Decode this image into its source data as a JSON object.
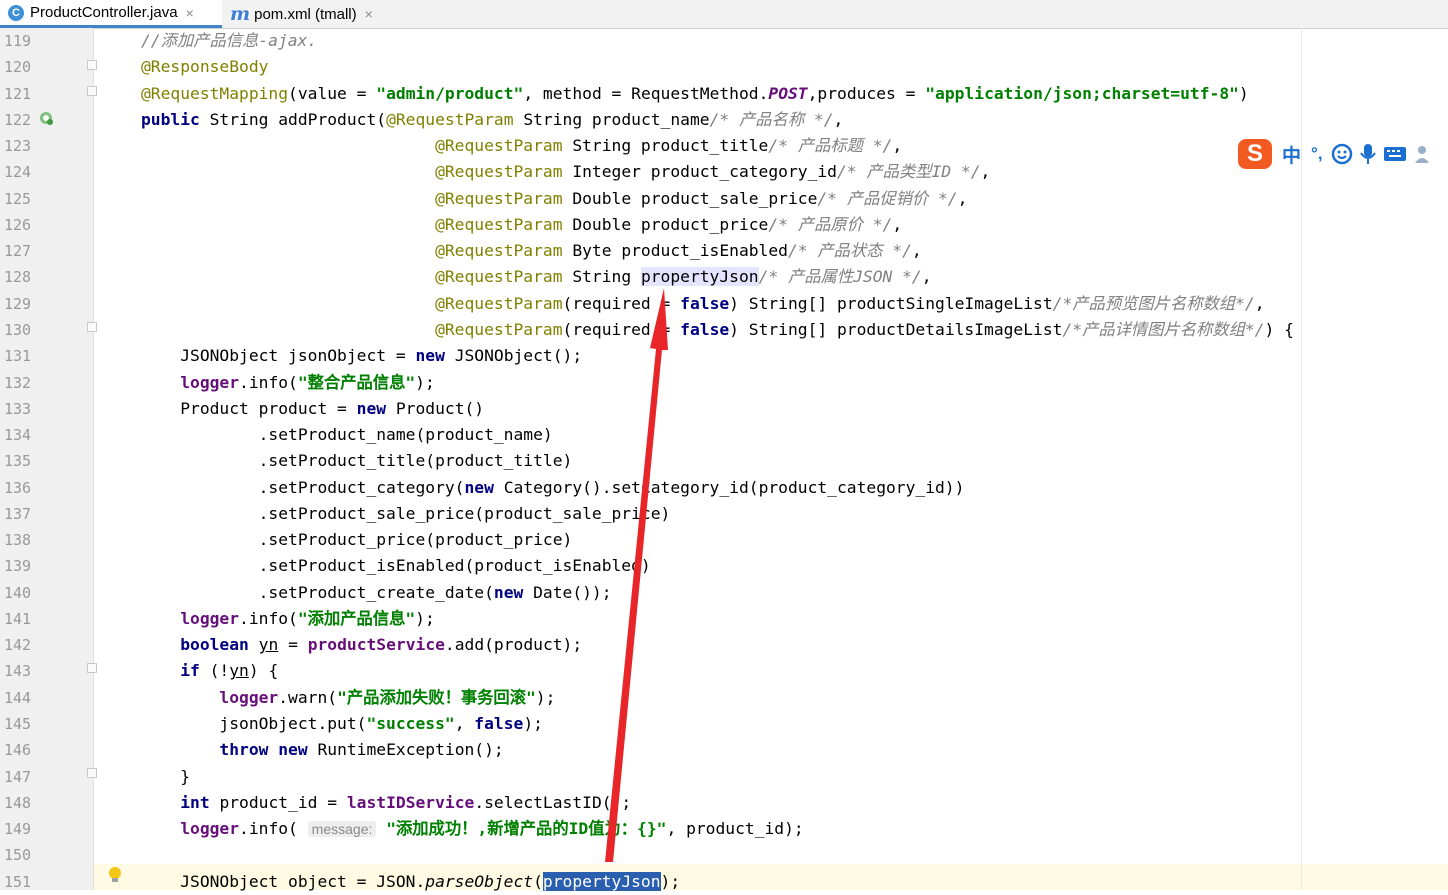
{
  "tabs": [
    {
      "label": "ProductController.java",
      "icon": "java-class-icon",
      "icon_glyph": "C",
      "active": true
    },
    {
      "label": "pom.xml (tmall)",
      "icon": "maven-icon",
      "icon_glyph": "m",
      "active": false
    }
  ],
  "tab_close_glyph": "×",
  "ime_toolbar": {
    "logo": "S",
    "lang": "中",
    "punct": "°,",
    "icons": [
      "emoji-icon",
      "microphone-icon",
      "keyboard-icon",
      "user-icon"
    ]
  },
  "inline_hint": "message:",
  "colors": {
    "keyword": "#000080",
    "annotation": "#808000",
    "string": "#008000",
    "comment": "#808080",
    "field": "#660e7a",
    "selection": "#2a5fb0",
    "arrow": "#e8262a"
  },
  "lines": [
    {
      "n": "119",
      "segs": [
        [
          "cm",
          "//添加产品信息-ajax."
        ]
      ]
    },
    {
      "n": "120",
      "segs": [
        [
          "ann",
          "@ResponseBody"
        ]
      ]
    },
    {
      "n": "121",
      "segs": [
        [
          "ann",
          "@RequestMapping"
        ],
        [
          "",
          "(value = "
        ],
        [
          "str",
          "\"admin/product\""
        ],
        [
          "",
          ", method = RequestMethod."
        ],
        [
          "stat",
          "POST"
        ],
        [
          "",
          ",produces = "
        ],
        [
          "str",
          "\"application/json;charset=utf-8\""
        ],
        [
          "",
          ")"
        ]
      ]
    },
    {
      "n": "122",
      "segs": [
        [
          "kw",
          "public"
        ],
        [
          "",
          " String addProduct("
        ],
        [
          "ann",
          "@RequestParam"
        ],
        [
          "",
          " String product_name"
        ],
        [
          "cm",
          "/* 产品名称 */"
        ],
        [
          "",
          ","
        ]
      ]
    },
    {
      "n": "123",
      "segs": [
        [
          "",
          "                              "
        ],
        [
          "ann",
          "@RequestParam"
        ],
        [
          "",
          " String product_title"
        ],
        [
          "cm",
          "/* 产品标题 */"
        ],
        [
          "",
          ","
        ]
      ]
    },
    {
      "n": "124",
      "segs": [
        [
          "",
          "                              "
        ],
        [
          "ann",
          "@RequestParam"
        ],
        [
          "",
          " Integer product_category_id"
        ],
        [
          "cm",
          "/* 产品类型ID */"
        ],
        [
          "",
          ","
        ]
      ]
    },
    {
      "n": "125",
      "segs": [
        [
          "",
          "                              "
        ],
        [
          "ann",
          "@RequestParam"
        ],
        [
          "",
          " Double product_sale_price"
        ],
        [
          "cm",
          "/* 产品促销价 */"
        ],
        [
          "",
          ","
        ]
      ]
    },
    {
      "n": "126",
      "segs": [
        [
          "",
          "                              "
        ],
        [
          "ann",
          "@RequestParam"
        ],
        [
          "",
          " Double product_price"
        ],
        [
          "cm",
          "/* 产品原价 */"
        ],
        [
          "",
          ","
        ]
      ]
    },
    {
      "n": "127",
      "segs": [
        [
          "",
          "                              "
        ],
        [
          "ann",
          "@RequestParam"
        ],
        [
          "",
          " Byte product_isEnabled"
        ],
        [
          "cm",
          "/* 产品状态 */"
        ],
        [
          "",
          ","
        ]
      ]
    },
    {
      "n": "128",
      "segs": [
        [
          "",
          "                              "
        ],
        [
          "ann",
          "@RequestParam"
        ],
        [
          "",
          " String "
        ],
        [
          "hl",
          "propertyJson"
        ],
        [
          "cm",
          "/* 产品属性JSON */"
        ],
        [
          "",
          ","
        ]
      ]
    },
    {
      "n": "129",
      "segs": [
        [
          "",
          "                              "
        ],
        [
          "ann",
          "@RequestParam"
        ],
        [
          "",
          "(required = "
        ],
        [
          "kw",
          "false"
        ],
        [
          "",
          ") String[] productSingleImageList"
        ],
        [
          "cm",
          "/*产品预览图片名称数组*/"
        ],
        [
          "",
          ","
        ]
      ]
    },
    {
      "n": "130",
      "segs": [
        [
          "",
          "                              "
        ],
        [
          "ann",
          "@RequestParam"
        ],
        [
          "",
          "(required = "
        ],
        [
          "kw",
          "false"
        ],
        [
          "",
          ") String[] productDetailsImageList"
        ],
        [
          "cm",
          "/*产品详情图片名称数组*/"
        ],
        [
          "",
          ") {"
        ]
      ]
    },
    {
      "n": "131",
      "segs": [
        [
          "",
          "    JSONObject jsonObject = "
        ],
        [
          "kw",
          "new"
        ],
        [
          "",
          " JSONObject();"
        ]
      ]
    },
    {
      "n": "132",
      "segs": [
        [
          "",
          "    "
        ],
        [
          "fld",
          "logger"
        ],
        [
          "",
          ".info("
        ],
        [
          "str",
          "\"整合产品信息\""
        ],
        [
          "",
          ");"
        ]
      ]
    },
    {
      "n": "133",
      "segs": [
        [
          "",
          "    Product product = "
        ],
        [
          "kw",
          "new"
        ],
        [
          "",
          " Product()"
        ]
      ]
    },
    {
      "n": "134",
      "segs": [
        [
          "",
          "            .setProduct_name(product_name)"
        ]
      ]
    },
    {
      "n": "135",
      "segs": [
        [
          "",
          "            .setProduct_title(product_title)"
        ]
      ]
    },
    {
      "n": "136",
      "segs": [
        [
          "",
          "            .setProduct_category("
        ],
        [
          "kw",
          "new"
        ],
        [
          "",
          " Category().setCategory_id(product_category_id))"
        ]
      ]
    },
    {
      "n": "137",
      "segs": [
        [
          "",
          "            .setProduct_sale_price(product_sale_price)"
        ]
      ]
    },
    {
      "n": "138",
      "segs": [
        [
          "",
          "            .setProduct_price(product_price)"
        ]
      ]
    },
    {
      "n": "139",
      "segs": [
        [
          "",
          "            .setProduct_isEnabled(product_isEnabled)"
        ]
      ]
    },
    {
      "n": "140",
      "segs": [
        [
          "",
          "            .setProduct_create_date("
        ],
        [
          "kw",
          "new"
        ],
        [
          "",
          " Date());"
        ]
      ]
    },
    {
      "n": "141",
      "segs": [
        [
          "",
          "    "
        ],
        [
          "fld",
          "logger"
        ],
        [
          "",
          ".info("
        ],
        [
          "str",
          "\"添加产品信息\""
        ],
        [
          "",
          ");"
        ]
      ]
    },
    {
      "n": "142",
      "segs": [
        [
          "",
          "    "
        ],
        [
          "kw",
          "boolean"
        ],
        [
          "",
          " "
        ],
        [
          "und",
          "yn"
        ],
        [
          "",
          " = "
        ],
        [
          "fld",
          "productService"
        ],
        [
          "",
          ".add(product);"
        ]
      ]
    },
    {
      "n": "143",
      "segs": [
        [
          "",
          "    "
        ],
        [
          "kw",
          "if"
        ],
        [
          "",
          " (!"
        ],
        [
          "und",
          "yn"
        ],
        [
          "",
          ") {"
        ]
      ]
    },
    {
      "n": "144",
      "segs": [
        [
          "",
          "        "
        ],
        [
          "fld",
          "logger"
        ],
        [
          "",
          ".warn("
        ],
        [
          "str",
          "\"产品添加失败！事务回滚\""
        ],
        [
          "",
          ");"
        ]
      ]
    },
    {
      "n": "145",
      "segs": [
        [
          "",
          "        jsonObject.put("
        ],
        [
          "str",
          "\"success\""
        ],
        [
          "",
          ", "
        ],
        [
          "kw",
          "false"
        ],
        [
          "",
          ");"
        ]
      ]
    },
    {
      "n": "146",
      "segs": [
        [
          "",
          "        "
        ],
        [
          "kw",
          "throw"
        ],
        [
          "",
          " "
        ],
        [
          "kw",
          "new"
        ],
        [
          "",
          " RuntimeException();"
        ]
      ]
    },
    {
      "n": "147",
      "segs": [
        [
          "",
          "    }"
        ]
      ]
    },
    {
      "n": "148",
      "segs": [
        [
          "",
          "    "
        ],
        [
          "kw",
          "int"
        ],
        [
          "",
          " product_id = "
        ],
        [
          "fld",
          "lastIDService"
        ],
        [
          "",
          ".selectLastID();"
        ]
      ]
    },
    {
      "n": "149",
      "segs": [
        [
          "",
          "    "
        ],
        [
          "fld",
          "logger"
        ],
        [
          "",
          ".info( "
        ],
        [
          "hint",
          "message:"
        ],
        [
          "",
          " "
        ],
        [
          "str",
          "\"添加成功！,新增产品的ID值为：{}\""
        ],
        [
          "",
          ", product_id);"
        ]
      ]
    },
    {
      "n": "150",
      "segs": []
    },
    {
      "n": "151",
      "segs": [
        [
          "",
          "    JSONObject object = JSON."
        ],
        [
          "it",
          "parseObject"
        ],
        [
          "",
          "("
        ],
        [
          "sel",
          "propertyJson"
        ],
        [
          "",
          ");"
        ]
      ]
    }
  ]
}
